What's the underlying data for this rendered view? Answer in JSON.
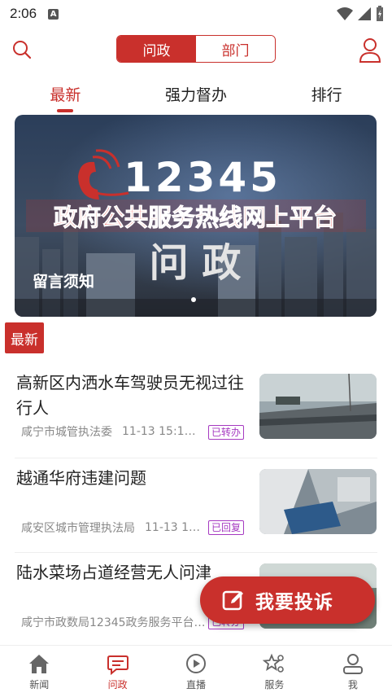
{
  "status_bar": {
    "time": "2:06",
    "notification_icon": "A"
  },
  "header": {
    "segments": [
      "问政",
      "部门"
    ],
    "active_segment": "问政"
  },
  "tabs": [
    {
      "label": "最新",
      "active": true
    },
    {
      "label": "强力督办",
      "active": false
    },
    {
      "label": "排行",
      "active": false
    }
  ],
  "banner": {
    "hotline_number": "12345",
    "headline": "政府公共服务热线网上平台",
    "big_text": "问 政",
    "caption": "留言须知"
  },
  "section_tag": "最新",
  "news": [
    {
      "title": "高新区内洒水车驾驶员无视过往行人",
      "department": "咸宁市城管执法委",
      "time": "11-13  15:1…",
      "status": "已转办"
    },
    {
      "title": "越通华府违建问题",
      "department": "咸安区城市管理执法局",
      "time": "11-13  1…",
      "status": "已回复"
    },
    {
      "title": "陆水菜场占道经营无人问津",
      "department": "咸宁市政数局12345政务服务平台…",
      "time": "",
      "status": "已转办"
    }
  ],
  "fab": {
    "label": "我要投诉"
  },
  "bottom_nav": [
    {
      "label": "新闻",
      "icon": "home-icon",
      "active": false
    },
    {
      "label": "问政",
      "icon": "chat-icon",
      "active": true
    },
    {
      "label": "直播",
      "icon": "play-icon",
      "active": false
    },
    {
      "label": "服务",
      "icon": "service-icon",
      "active": false
    },
    {
      "label": "我",
      "icon": "person-icon",
      "active": false
    }
  ],
  "colors": {
    "accent": "#c9302c",
    "badge": "#a63ac1"
  }
}
